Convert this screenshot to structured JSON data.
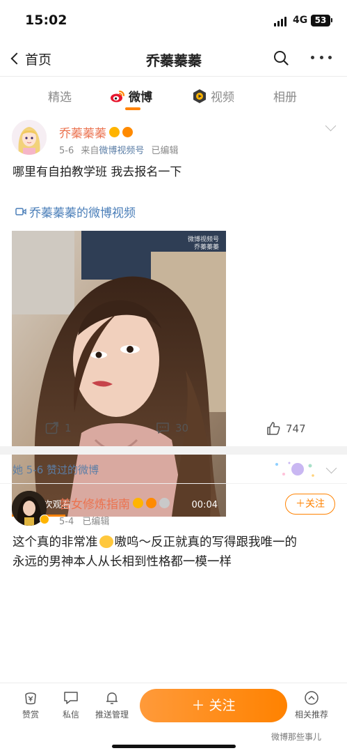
{
  "status": {
    "time": "15:02",
    "network": "4G",
    "battery": "53"
  },
  "nav": {
    "back_label": "首页",
    "title": "乔蓁蓁蓁"
  },
  "tabs": [
    {
      "label": "精选"
    },
    {
      "label": "微博"
    },
    {
      "label": "视频"
    },
    {
      "label": "相册"
    }
  ],
  "post": {
    "author": "乔蓁蓁蓁",
    "date": "5-6",
    "source_prefix": "来自",
    "source": "微博视频号",
    "edited": "已编辑",
    "text": "哪里有自拍教学班 我去报名一下",
    "video_link": "乔蓁蓁蓁的微博视频",
    "video": {
      "views": "9.1万次观看",
      "duration": "00:04",
      "watermark_line1": "微博视频号",
      "watermark_line2": "乔蓁蓁蓁"
    },
    "actions": {
      "reposts": "1",
      "comments": "30",
      "likes": "747"
    }
  },
  "liked_section": {
    "title": "她 5-6 赞过的微博"
  },
  "post2": {
    "author": "普女修炼指南",
    "date": "5-4",
    "edited": "已编辑",
    "follow_label": "＋关注",
    "text_line1": "这个真的非常准",
    "text_line1_rest": "嗷呜～反正就真的写得跟我唯一的",
    "text_line2": "永远的男神本人从长相到性格都一模一样"
  },
  "bottom_bar": {
    "reward": "赞赏",
    "message": "私信",
    "push": "推送管理",
    "follow": "＋ 关注",
    "related": "相关推荐",
    "watermark": "微博那些事儿"
  },
  "colors": {
    "accent": "#ff8200",
    "name": "#eb7350",
    "link": "#4a7eb8"
  },
  "icons": [
    "back-chevron-icon",
    "search-icon",
    "more-icon",
    "weibo-icon",
    "video-icon",
    "repost-icon",
    "comment-icon",
    "like-icon",
    "reward-icon",
    "message-icon",
    "bell-icon",
    "related-icon"
  ]
}
